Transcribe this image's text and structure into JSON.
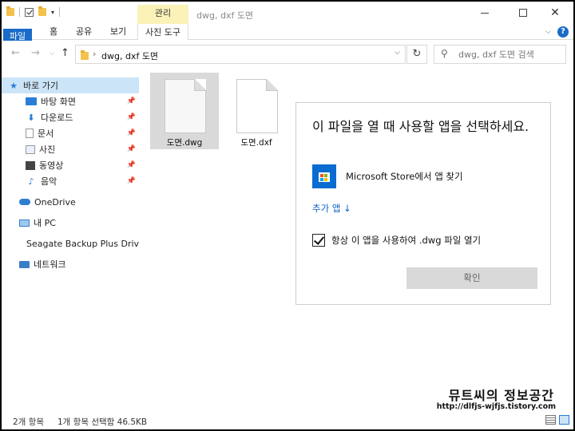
{
  "window": {
    "title": "dwg, dxf 도면",
    "contextual_tab": "관리"
  },
  "ribbon": {
    "tabs": [
      "파일",
      "홈",
      "공유",
      "보기",
      "사진 도구"
    ]
  },
  "address": {
    "path": "dwg, dxf 도면",
    "search_placeholder": "dwg, dxf 도면 검색"
  },
  "sidebar": {
    "items": [
      {
        "label": "바로 가기",
        "icon": "star-icon"
      },
      {
        "label": "바탕 화면",
        "icon": "desktop-icon",
        "pinned": true
      },
      {
        "label": "다운로드",
        "icon": "download-icon",
        "pinned": true
      },
      {
        "label": "문서",
        "icon": "document-icon",
        "pinned": true
      },
      {
        "label": "사진",
        "icon": "picture-icon",
        "pinned": true
      },
      {
        "label": "동영상",
        "icon": "video-icon",
        "pinned": true
      },
      {
        "label": "음악",
        "icon": "music-icon",
        "pinned": true
      },
      {
        "label": "OneDrive",
        "icon": "cloud-icon"
      },
      {
        "label": "내 PC",
        "icon": "pc-icon"
      },
      {
        "label": "Seagate Backup Plus Drive (E",
        "icon": "drive-icon"
      },
      {
        "label": "네트워크",
        "icon": "network-icon"
      }
    ]
  },
  "files": [
    {
      "name": "도면.dwg",
      "selected": true
    },
    {
      "name": "도면.dxf",
      "selected": false
    }
  ],
  "dialog": {
    "title": "이 파일을 열 때 사용할 앱을 선택하세요.",
    "store_label": "Microsoft Store에서 앱 찾기",
    "more_apps": "추가 앱 ↓",
    "always_label": "항상 이 앱을 사용하여 .dwg 파일 열기",
    "always_checked": true,
    "ok_label": "확인"
  },
  "status": {
    "item_count": "2개 항목",
    "selection": "1개 항목 선택함 46.5KB"
  },
  "watermark": {
    "line1": "뮤트씨의 정보공간",
    "line2": "http://dlfjs-wjfjs.tistory.com"
  },
  "colors": {
    "accent": "#1a6bc8",
    "selection": "#cce4f7",
    "manage_tab": "#fbf2b8"
  }
}
